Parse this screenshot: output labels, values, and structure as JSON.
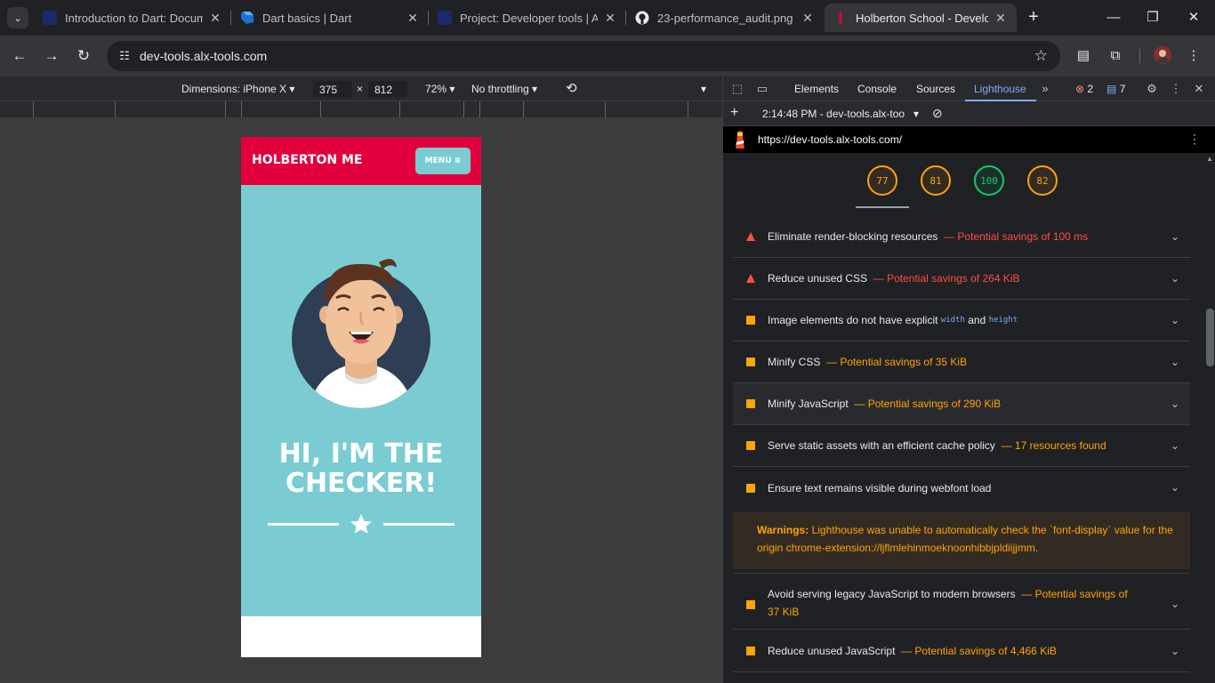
{
  "tabs": [
    {
      "title": "Introduction to Dart: Docum",
      "favicon": "alx-icon"
    },
    {
      "title": "Dart basics | Dart",
      "favicon": "dart-icon"
    },
    {
      "title": "Project: Developer tools | AL",
      "favicon": "alx-icon"
    },
    {
      "title": "23-performance_audit.png - ",
      "favicon": "github-icon"
    },
    {
      "title": "Holberton School - Develop",
      "favicon": "holberton-icon"
    }
  ],
  "omnibox": {
    "url": "dev-tools.alx-tools.com"
  },
  "device_toolbar": {
    "dimensions_label": "Dimensions: iPhone X",
    "width": "375",
    "height": "812",
    "x_sep": "×",
    "zoom": "72%",
    "throttling": "No throttling"
  },
  "page": {
    "brand": "HOLBERTON ME",
    "menu_label": "MENU ≡",
    "heading_line1": "HI, I'M THE",
    "heading_line2": "CHECKER!"
  },
  "devtools": {
    "tabs": [
      "Elements",
      "Console",
      "Sources",
      "Lighthouse"
    ],
    "active_tab": "Lighthouse",
    "error_count": "2",
    "message_count": "7",
    "report_select": "2:14:48 PM - dev-tools.alx-too",
    "report_url": "https://dev-tools.alx-tools.com/",
    "scores": [
      {
        "value": "77",
        "status": "average"
      },
      {
        "value": "81",
        "status": "average"
      },
      {
        "value": "100",
        "status": "pass"
      },
      {
        "value": "82",
        "status": "average"
      }
    ],
    "audits": [
      {
        "title": "Eliminate render-blocking resources",
        "savings": "— Potential savings of 100 ms",
        "status": "fail"
      },
      {
        "title": "Reduce unused CSS",
        "savings": "— Potential savings of 264 KiB",
        "status": "fail"
      },
      {
        "title_pre": "Image elements do not have explicit",
        "code1": "width",
        "and": "and",
        "code2": "height",
        "status": "average"
      },
      {
        "title": "Minify CSS",
        "savings": "— Potential savings of 35 KiB",
        "status": "average"
      },
      {
        "title": "Minify JavaScript",
        "savings": "— Potential savings of 290 KiB",
        "status": "average"
      },
      {
        "title": "Serve static assets with an efficient cache policy",
        "savings": "— 17 resources found",
        "status": "average"
      },
      {
        "title": "Ensure text remains visible during webfont load",
        "savings": "",
        "status": "average"
      },
      {
        "title": "Avoid serving legacy JavaScript to modern browsers",
        "savings": "— Potential savings of",
        "savings2": "37 KiB",
        "status": "average"
      },
      {
        "title": "Reduce unused JavaScript",
        "savings": "— Potential savings of 4,466 KiB",
        "status": "average"
      }
    ],
    "warning": {
      "label": "Warnings:",
      "line1": "Lighthouse was unable to automatically check the `font-display` value for the",
      "line2": "origin chrome-extension://ljflmlehinmoeknoonhibbjpldiijjmm."
    }
  },
  "colors": {
    "fail": "#ff4e42",
    "average": "#ffa400",
    "pass": "#0cce6b",
    "brand_red": "#e1003c",
    "hero_teal": "#7accd2"
  }
}
